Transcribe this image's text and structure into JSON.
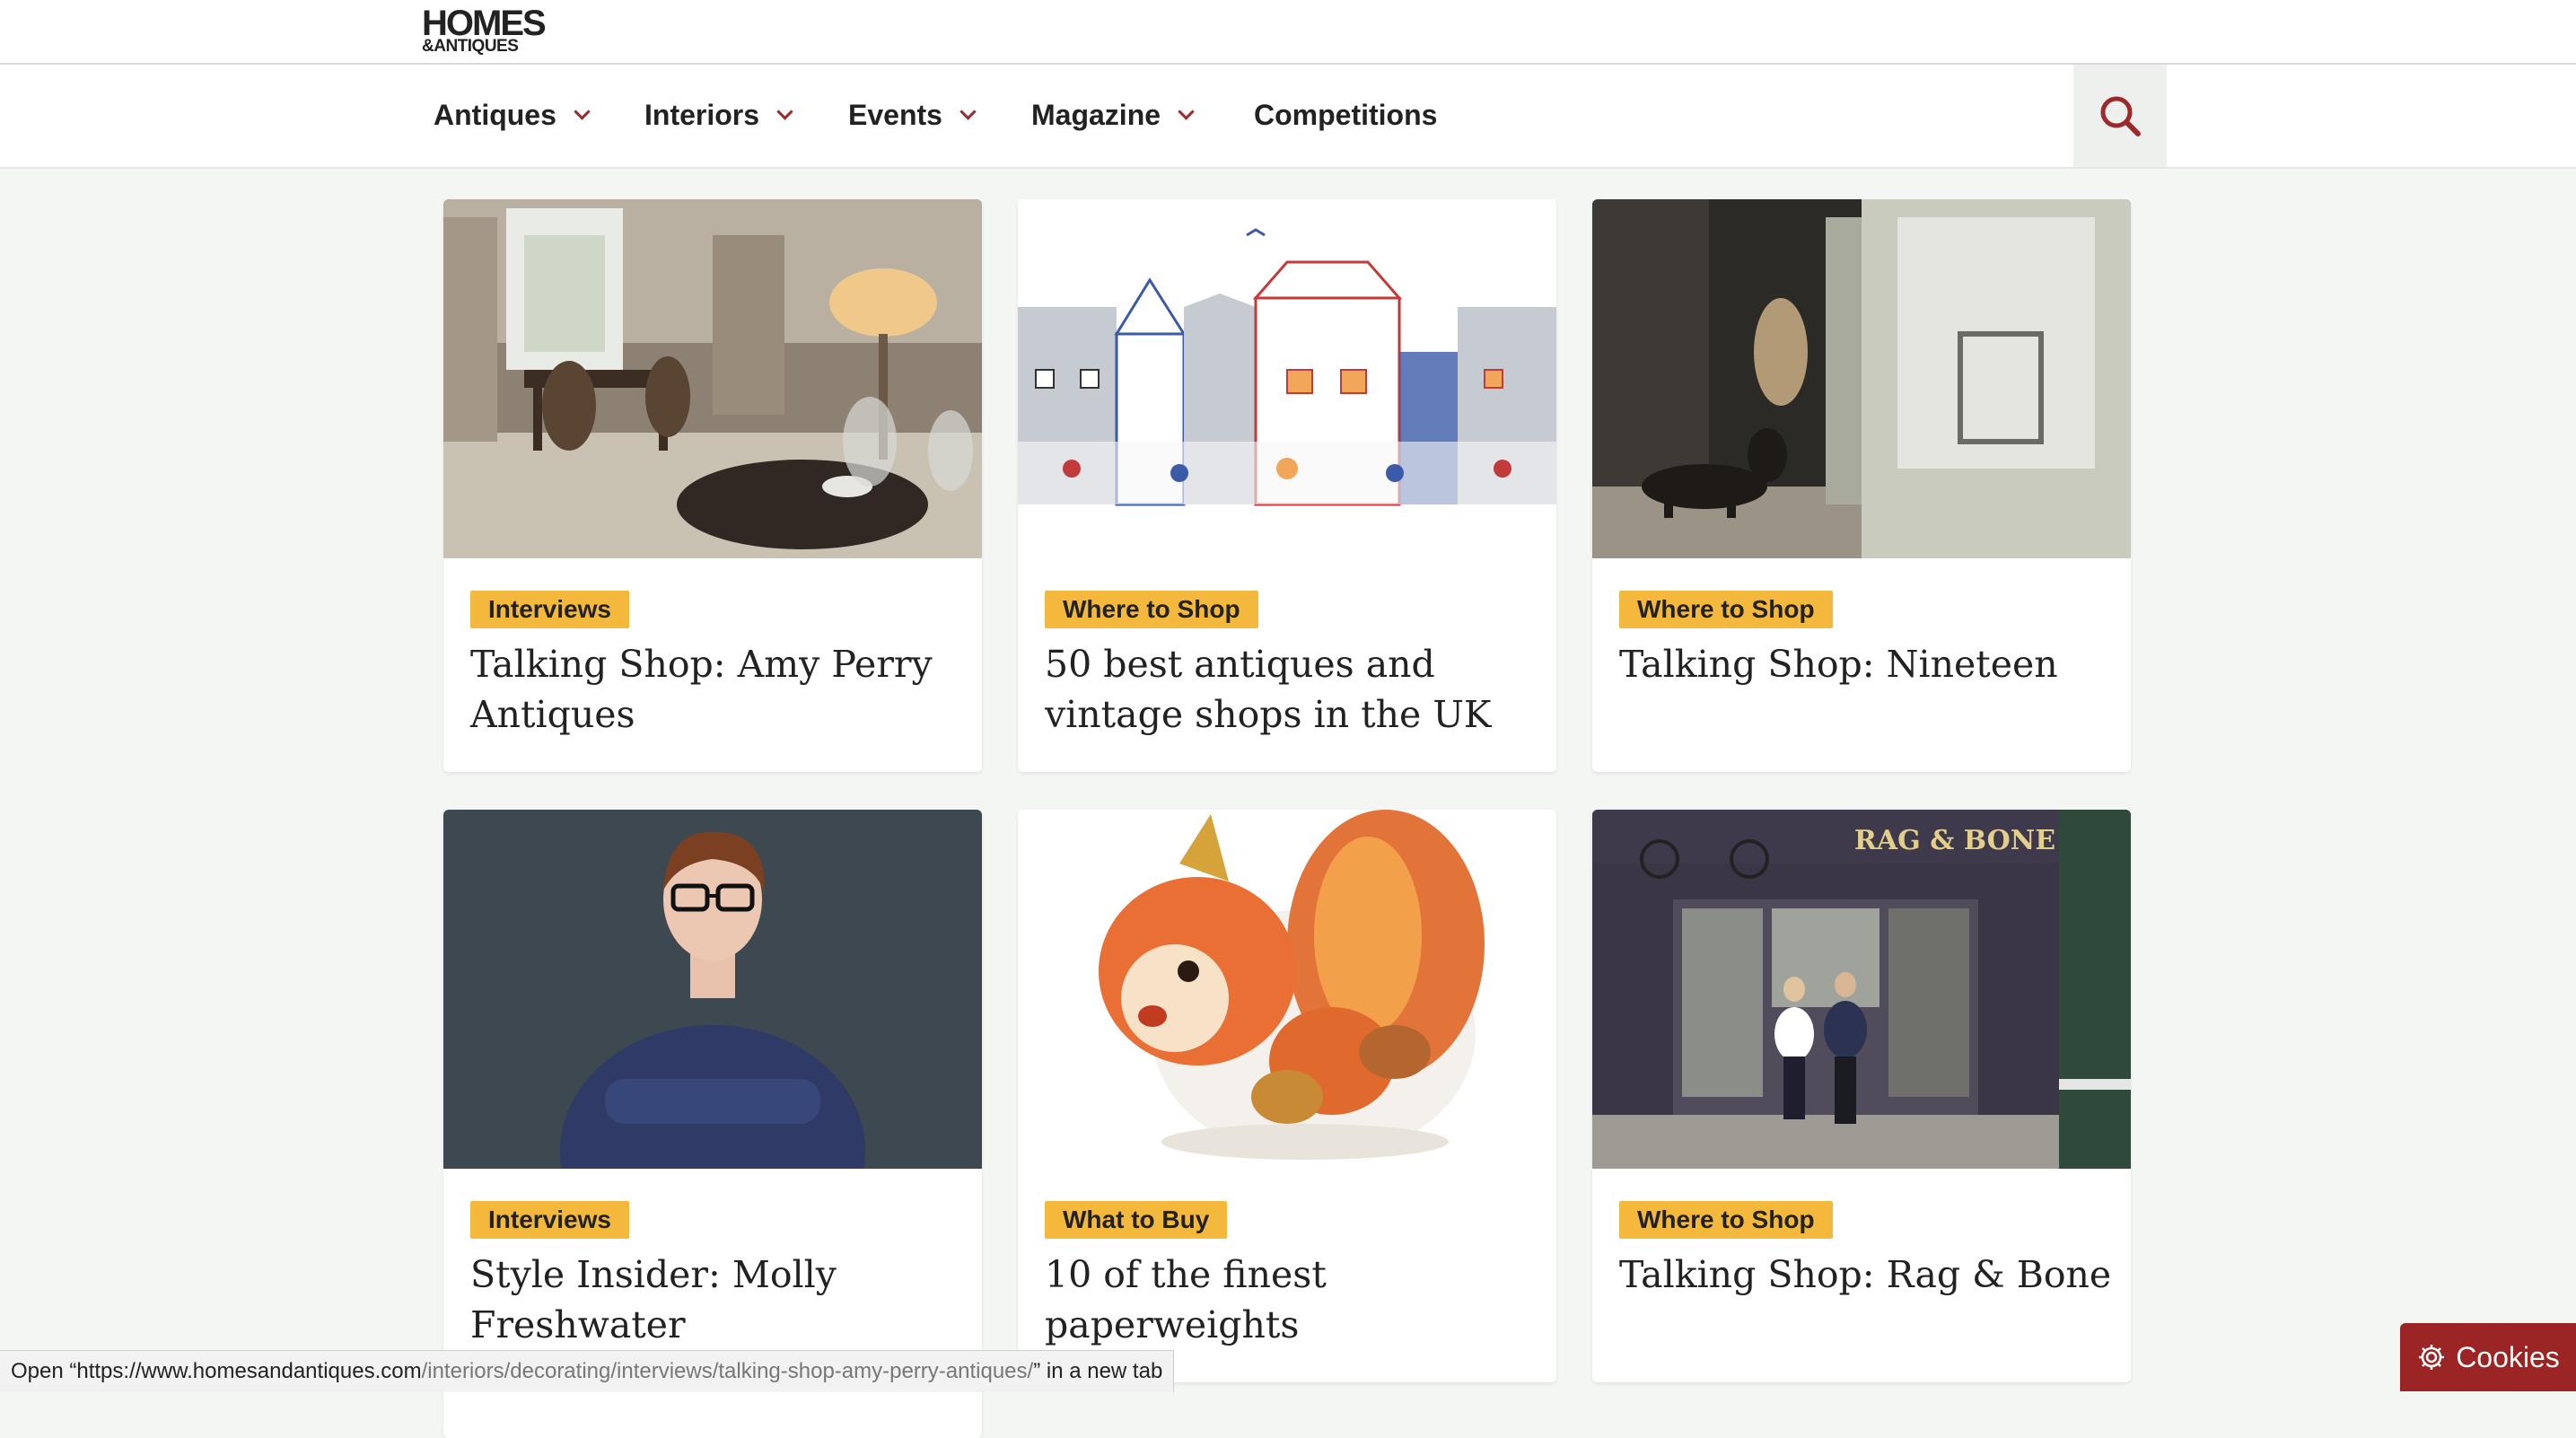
{
  "header": {
    "logo_top": "HOMES",
    "logo_bottom": "&ANTIQUES"
  },
  "nav": {
    "items": [
      {
        "label": "Antiques",
        "has_dropdown": true
      },
      {
        "label": "Interiors",
        "has_dropdown": true
      },
      {
        "label": "Events",
        "has_dropdown": true
      },
      {
        "label": "Magazine",
        "has_dropdown": true
      },
      {
        "label": "Competitions",
        "has_dropdown": false
      }
    ],
    "search_icon": "search-icon"
  },
  "cards": [
    {
      "category": "Interviews",
      "title": "Talking Shop: Amy Perry Antiques",
      "image": "antique-shop-interior"
    },
    {
      "category": "Where to Shop",
      "title": "50 best antiques and vintage shops in the UK",
      "image": "illustrated-shopfronts"
    },
    {
      "category": "Where to Shop",
      "title": "Talking Shop: Nineteen",
      "image": "dachshund-in-shop-doorway"
    },
    {
      "category": "Interviews",
      "title": "Style Insider: Molly Freshwater",
      "image": "woman-portrait"
    },
    {
      "category": "What to Buy",
      "title": "10 of the finest paperweights",
      "image": "squirrel-paperweight"
    },
    {
      "category": "Where to Shop",
      "title": "Talking Shop: Rag & Bone",
      "image": "rag-and-bone-shopfront",
      "sign_text": "RAG & BONE"
    }
  ],
  "status_bar": {
    "prefix": "Open “",
    "url_host": "https://www.homesandantiques.com",
    "url_path": "/interiors/decorating/interviews/talking-shop-amy-perry-antiques/",
    "suffix": "” in a new tab"
  },
  "cookies": {
    "label": "Cookies",
    "icon": "gear-icon"
  },
  "colors": {
    "accent": "#9b2424",
    "tag_bg": "#f4b93c",
    "page_bg": "#f4f6f4"
  }
}
